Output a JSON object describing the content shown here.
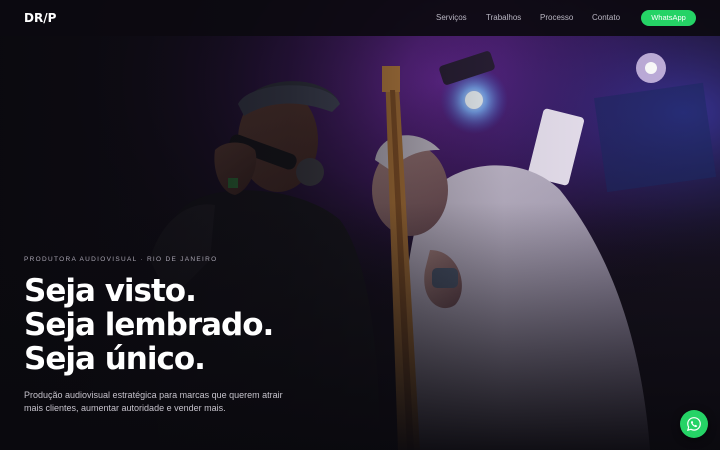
{
  "header": {
    "logo_text": "DR/P",
    "nav": {
      "services": "Serviços",
      "works": "Trabalhos",
      "process": "Processo",
      "contact": "Contato"
    },
    "cta_label": "WhatsApp"
  },
  "hero": {
    "eyebrow": "PRODUTORA AUDIOVISUAL · RIO DE JANEIRO",
    "headline": {
      "line1": "Seja visto.",
      "line2": "Seja lembrado.",
      "line3": "Seja único."
    },
    "subtext": "Produção audiovisual estratégica para marcas que querem atrair mais clientes, aumentar autoridade e vender mais.",
    "background_image": "concert-photo-singer-guitarist"
  },
  "floating_button": {
    "icon": "whatsapp-icon"
  },
  "colors": {
    "accent_green": "#25d366",
    "background": "#0b0a10",
    "stage_purple": "#6a2a9c"
  }
}
